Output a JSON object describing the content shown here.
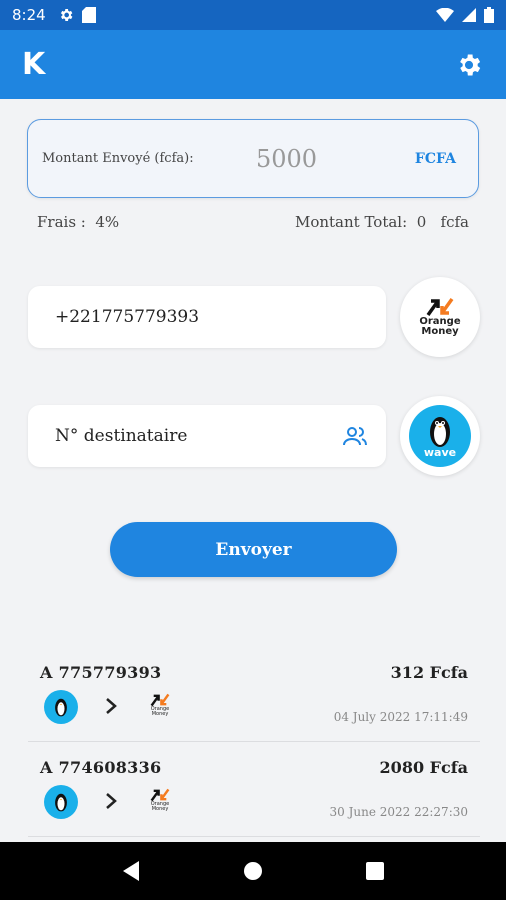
{
  "status_bar": {
    "time": "8:24"
  },
  "app": {
    "logo_text": "K",
    "accent": "#1f85e0"
  },
  "amount": {
    "label": "Montant Envoyé (fcfa):",
    "value": "5000",
    "currency": "FCFA"
  },
  "fees": {
    "label": "Frais :",
    "value": "4%",
    "total_label": "Montant Total:",
    "total_value": "0",
    "total_unit": "fcfa"
  },
  "sender_phone": "+221775779393",
  "recipient": {
    "placeholder": "N° destinataire"
  },
  "providers": {
    "orange_money": "Orange Money",
    "wave": "wave"
  },
  "send_button": "Envoyer",
  "history": [
    {
      "to": "A 775779393",
      "amount": "312 Fcfa",
      "date": "04 July 2022 17:11:49"
    },
    {
      "to": "A 774608336",
      "amount": "2080 Fcfa",
      "date": "30 June 2022 22:27:30"
    }
  ],
  "mini_om_text": "Orange Money"
}
